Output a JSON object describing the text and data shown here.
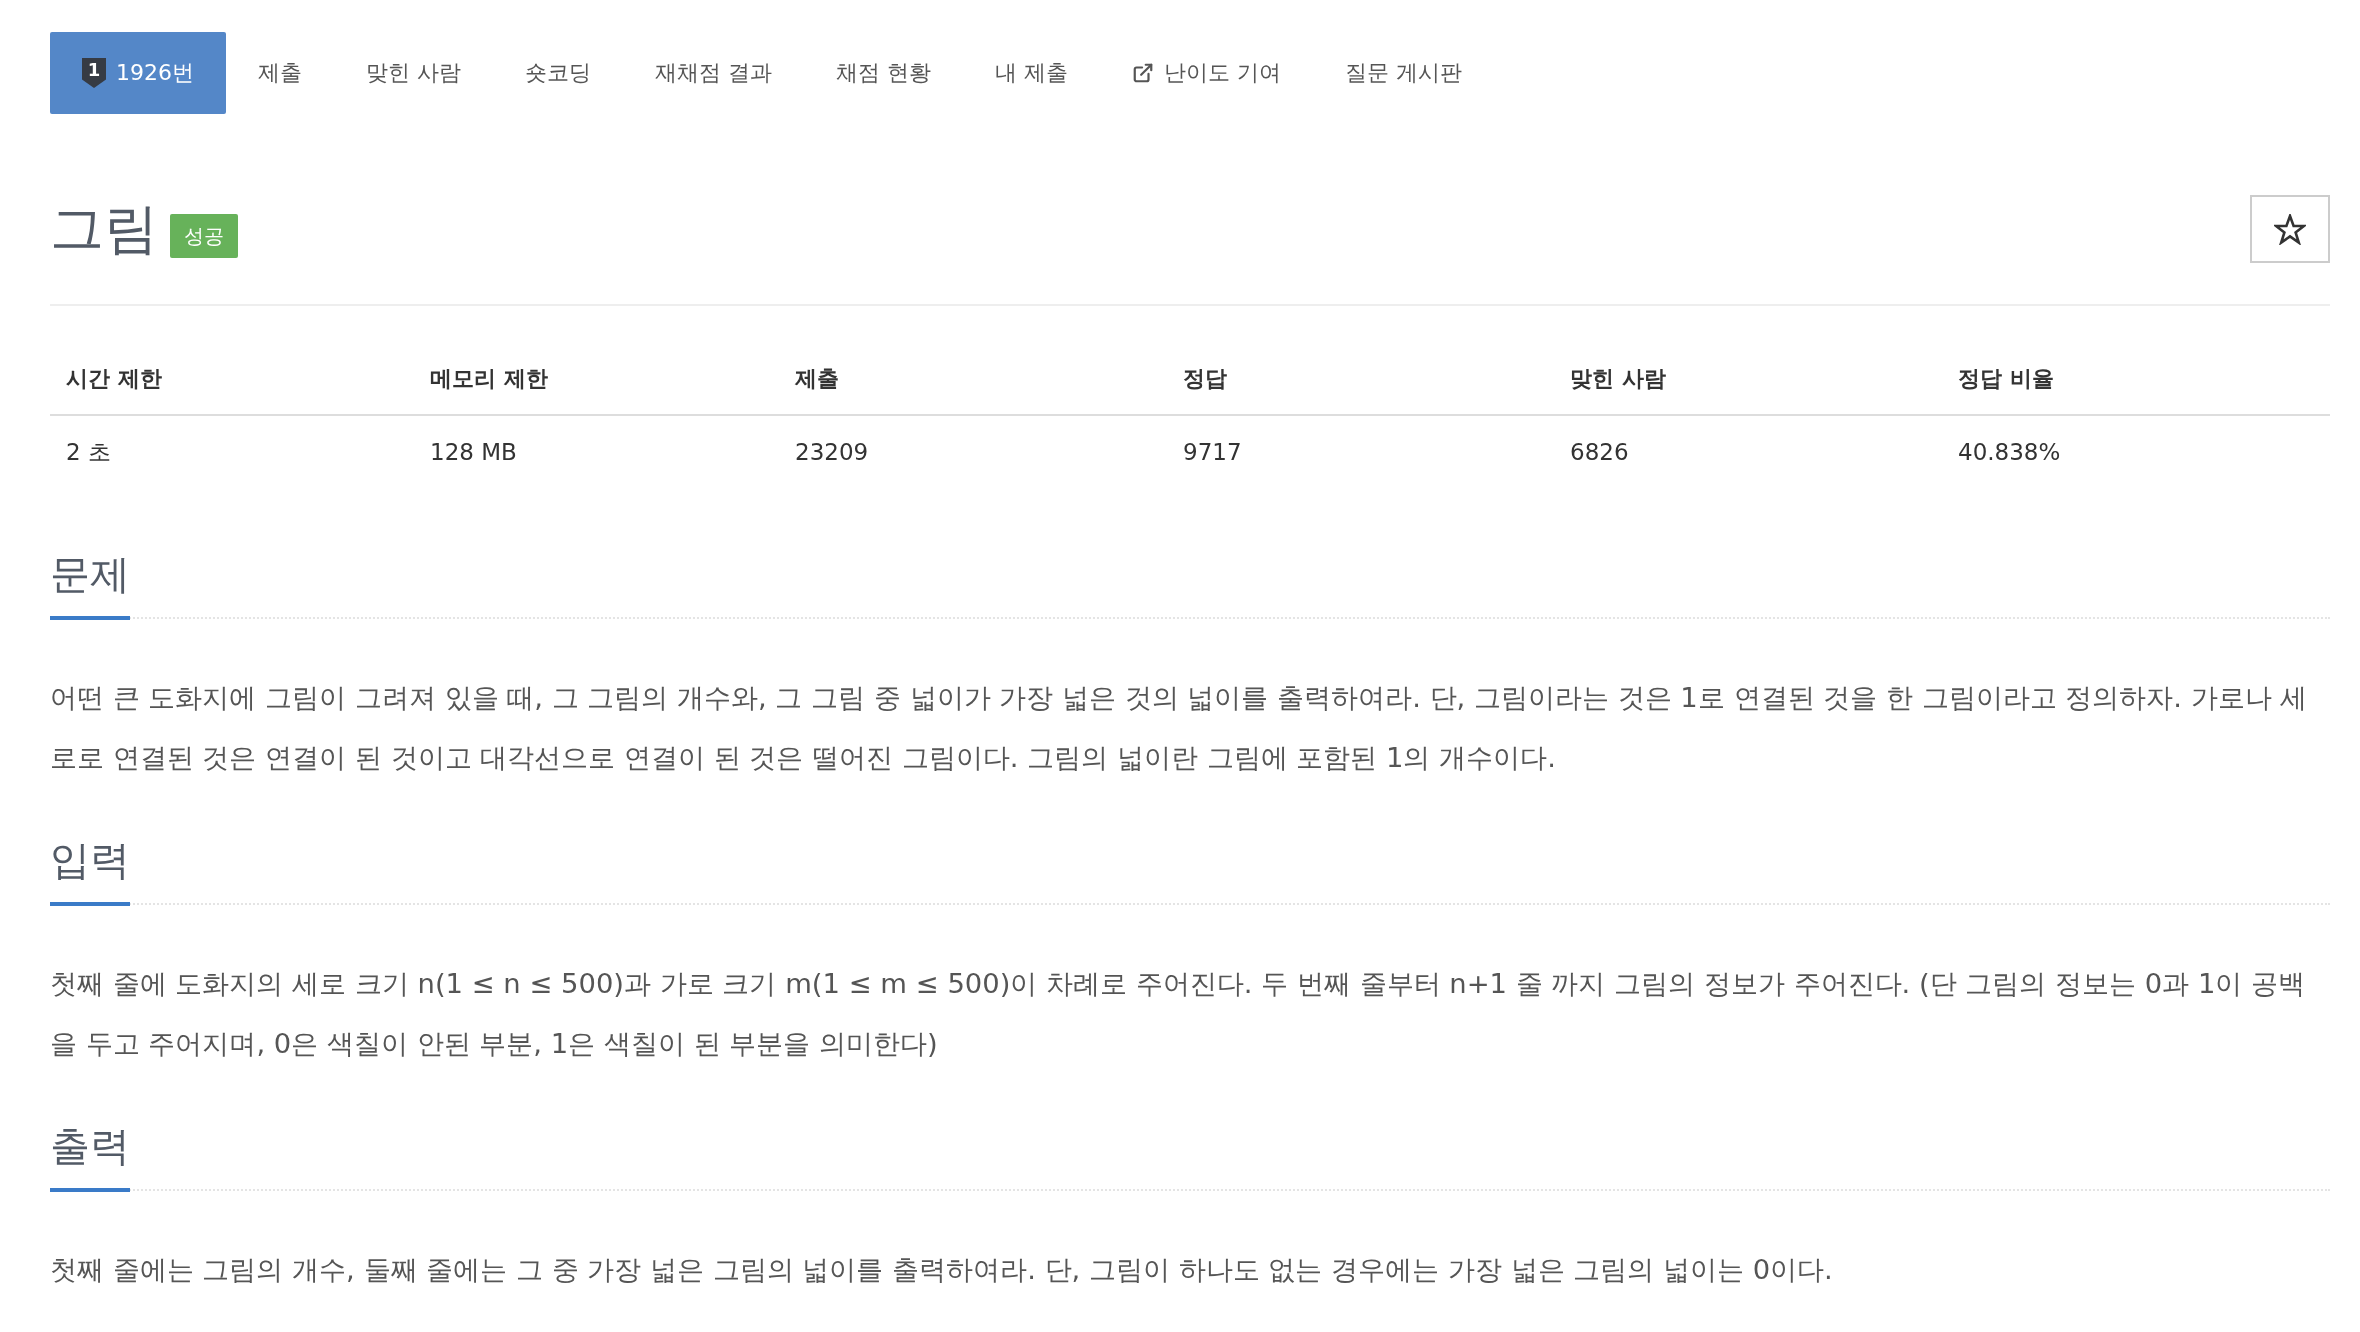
{
  "nav": {
    "tabs": [
      {
        "kind": "problem",
        "badge": "1",
        "label": "1926번",
        "selected": true
      },
      {
        "kind": "plain",
        "label": "제출",
        "selected": false
      },
      {
        "kind": "plain",
        "label": "맞힌 사람",
        "selected": false
      },
      {
        "kind": "plain",
        "label": "숏코딩",
        "selected": false
      },
      {
        "kind": "plain",
        "label": "재채점 결과",
        "selected": false
      },
      {
        "kind": "plain",
        "label": "채점 현황",
        "selected": false
      },
      {
        "kind": "plain",
        "label": "내 제출",
        "selected": false
      },
      {
        "kind": "external",
        "label": "난이도 기여",
        "selected": false
      },
      {
        "kind": "plain",
        "label": "질문 게시판",
        "selected": false
      }
    ]
  },
  "problem": {
    "title": "그림",
    "status": {
      "kind": "success",
      "label": "성공"
    },
    "starred": false
  },
  "info_table": {
    "columns": [
      "시간 제한",
      "메모리 제한",
      "제출",
      "정답",
      "맞힌 사람",
      "정답 비율"
    ],
    "rows": [
      [
        "2 초",
        "128 MB",
        "23209",
        "9717",
        "6826",
        "40.838%"
      ]
    ]
  },
  "sections": [
    {
      "heading": "문제",
      "text": "어떤 큰 도화지에 그림이 그려져 있을 때, 그 그림의 개수와, 그 그림 중 넓이가 가장 넓은 것의 넓이를 출력하여라. 단, 그림이라는 것은 1로 연결된 것을 한 그림이라고 정의하자. 가로나 세로로 연결된 것은 연결이 된 것이고 대각선으로 연결이 된 것은 떨어진 그림이다. 그림의 넓이란 그림에 포함된 1의 개수이다."
    },
    {
      "heading": "입력",
      "text": "첫째 줄에 도화지의 세로 크기 n(1 ≤ n ≤ 500)과 가로 크기 m(1 ≤ m ≤ 500)이 차례로 주어진다. 두 번째 줄부터 n+1 줄 까지 그림의 정보가 주어진다. (단 그림의 정보는 0과 1이 공백을 두고 주어지며, 0은 색칠이 안된 부분, 1은 색칠이 된 부분을 의미한다)"
    },
    {
      "heading": "출력",
      "text": "첫째 줄에는 그림의 개수, 둘째 줄에는 그 중 가장 넓은 그림의 넓이를 출력하여라. 단, 그림이 하나도 없는 경우에는 가장 넓은 그림의 넓이는 0이다."
    }
  ]
}
